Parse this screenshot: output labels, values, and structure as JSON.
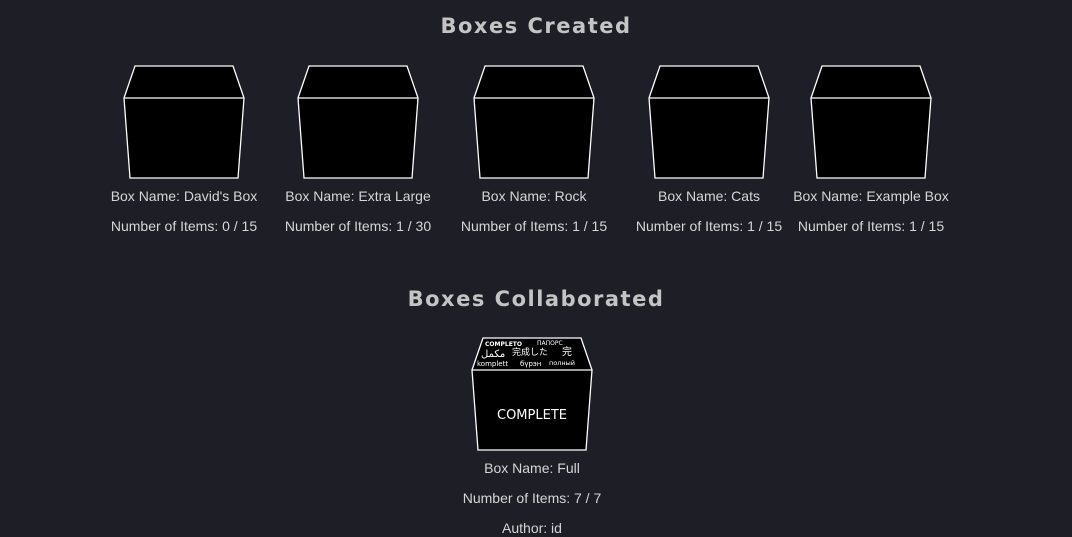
{
  "sections": {
    "created_title": "Boxes Created",
    "collaborated_title": "Boxes Collaborated"
  },
  "created_boxes": [
    {
      "name": "Box Name: David's Box",
      "items": "Number of Items: 0 / 15"
    },
    {
      "name": "Box Name: Extra Large",
      "items": "Number of Items: 1 / 30"
    },
    {
      "name": "Box Name: Rock",
      "items": "Number of Items: 1 / 15"
    },
    {
      "name": "Box Name: Cats",
      "items": "Number of Items: 1 / 15"
    },
    {
      "name": "Box Name: Example Box",
      "items": "Number of Items: 1 / 15"
    }
  ],
  "collaborated_boxes": [
    {
      "name": "Box Name: Full",
      "items": "Number of Items: 7 / 7",
      "extra": "Author: id",
      "label": "COMPLETE",
      "lid_words": [
        "COMPLETO",
        "ПАПОРС",
        "مكمل",
        "完成した",
        "完",
        "komplett",
        "бүрэн",
        "полный"
      ]
    }
  ],
  "colors": {
    "background": "#1e1e27",
    "box_fill": "#000000",
    "box_outline": "#ffffff",
    "title": "#c4c4c4",
    "text": "#d6d6d6"
  }
}
